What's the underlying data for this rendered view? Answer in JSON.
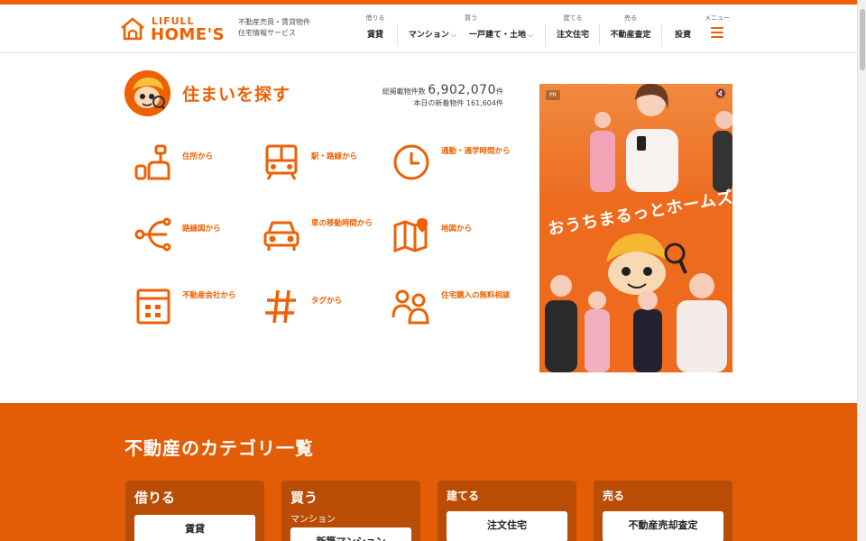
{
  "brand": {
    "logo_top": "LIFULL",
    "logo_main": "HOME'S",
    "tagline_line1": "不動産売買・賃貸物件",
    "tagline_line2": "住宅情報サービス",
    "accent_color": "#ed6103"
  },
  "nav": {
    "rent": {
      "caption": "借りる",
      "items": [
        "賃貸"
      ]
    },
    "buy": {
      "caption": "買う",
      "items": [
        "マンション",
        "一戸建て・土地"
      ]
    },
    "build": {
      "caption": "建てる",
      "items": [
        "注文住宅"
      ]
    },
    "sell": {
      "caption": "売る",
      "items": [
        "不動産査定"
      ]
    },
    "invest": {
      "label": "投資"
    },
    "menu": {
      "caption": "メニュー",
      "icon": "hamburger-icon"
    }
  },
  "search": {
    "title": "住まいを探す",
    "total_label": "総掲載物件数",
    "total_value": "6,902,070",
    "total_unit": "件",
    "new_label": "本日の新着物件",
    "new_value": "161,604",
    "new_unit": "件",
    "methods": [
      {
        "label": "住所から",
        "icon": "address-icon"
      },
      {
        "label": "駅・路線から",
        "icon": "train-icon"
      },
      {
        "label": "通勤・通学時間から",
        "icon": "clock-icon"
      },
      {
        "label": "路線図から",
        "icon": "route-map-icon"
      },
      {
        "label": "車の移動時間から",
        "icon": "car-icon"
      },
      {
        "label": "地図から",
        "icon": "map-icon"
      },
      {
        "label": "不動産会社から",
        "icon": "company-icon"
      },
      {
        "label": "タグから",
        "icon": "hashtag-icon"
      },
      {
        "label": "住宅購入の無料相談",
        "icon": "consult-icon"
      }
    ]
  },
  "ad": {
    "badge": "PR",
    "copy": "おうちまるっとホームズ",
    "mute_icon": "speaker-mute-icon"
  },
  "categories": {
    "title": "不動産のカテゴリ一覧",
    "cards": [
      {
        "heading": "借りる",
        "sub": "",
        "button": "賃貸"
      },
      {
        "heading": "買う",
        "sub": "マンション",
        "button": "新築マンション"
      },
      {
        "heading": "建てる",
        "sub": "",
        "button": "注文住宅"
      },
      {
        "heading": "売る",
        "sub": "",
        "button": "不動産売却査定"
      }
    ]
  }
}
